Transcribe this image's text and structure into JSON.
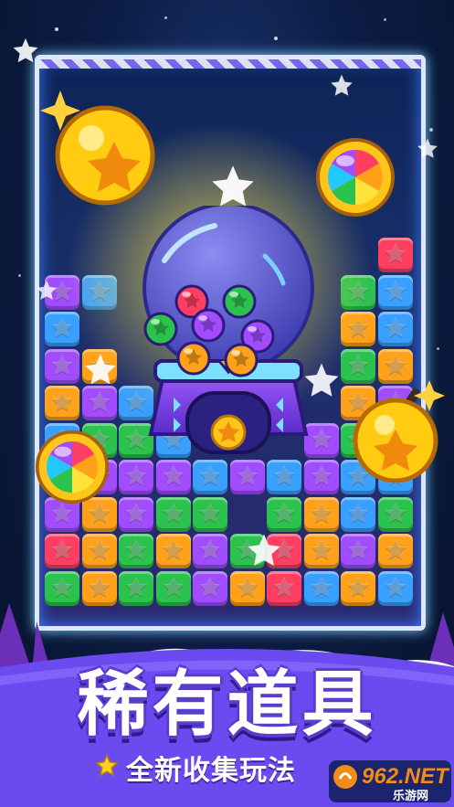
{
  "title": "稀有道具",
  "subtitle": "全新收集玩法",
  "watermark": {
    "number": "962.NET",
    "text": "乐游网"
  },
  "icons": {
    "bomb": "bomb-icon",
    "rainbow_ball": "rainbow-ball-icon",
    "gumball_machine": "gumball-machine-icon",
    "star": "star-icon"
  },
  "colors": {
    "blue": "#3aa0ff",
    "purple": "#a24cff",
    "green": "#2cc24e",
    "orange": "#ffa21a",
    "red": "#ff3f61",
    "yellow": "#ffd21c",
    "cyan": "#23c8ff",
    "banner": "#6b4af0"
  },
  "board": [
    [
      "",
      "",
      "",
      "",
      "",
      "",
      "",
      "",
      "",
      "red"
    ],
    [
      "purple",
      "blue",
      "",
      "",
      "",
      "",
      "",
      "",
      "green",
      "blue"
    ],
    [
      "blue",
      "",
      "",
      "",
      "",
      "",
      "",
      "",
      "orange",
      "blue"
    ],
    [
      "purple",
      "orange",
      "",
      "",
      "",
      "",
      "",
      "",
      "green",
      "orange"
    ],
    [
      "orange",
      "purple",
      "blue",
      "",
      "",
      "",
      "",
      "",
      "orange",
      "purple"
    ],
    [
      "blue",
      "green",
      "green",
      "blue",
      "",
      "",
      "",
      "purple",
      "green",
      "purple"
    ],
    [
      "green",
      "purple",
      "purple",
      "purple",
      "blue",
      "purple",
      "blue",
      "purple",
      "blue",
      "blue"
    ],
    [
      "purple",
      "orange",
      "purple",
      "green",
      "green",
      "",
      "green",
      "orange",
      "blue",
      "green"
    ],
    [
      "red",
      "orange",
      "green",
      "orange",
      "purple",
      "green",
      "red",
      "orange",
      "purple",
      "orange"
    ],
    [
      "green",
      "orange",
      "green",
      "green",
      "purple",
      "orange",
      "red",
      "blue",
      "orange",
      "blue"
    ]
  ],
  "gumballs": [
    "red",
    "green",
    "green",
    "purple",
    "purple",
    "orange",
    "orange"
  ]
}
